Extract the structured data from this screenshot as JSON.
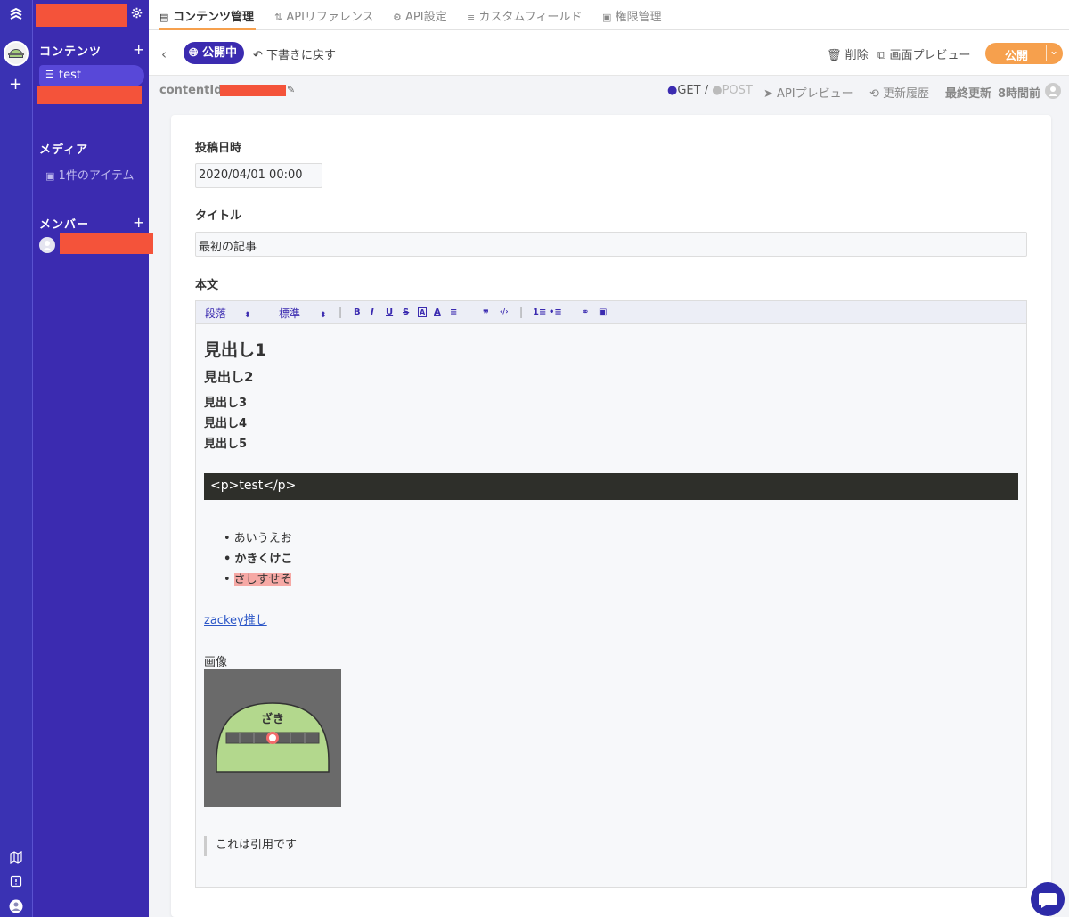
{
  "rail": {
    "plus": "+",
    "icons": [
      "map-icon",
      "alert-icon",
      "user-icon"
    ]
  },
  "sidebar": {
    "sections": [
      {
        "title": "コンテンツ",
        "plus": "+"
      },
      {
        "title": "メディア"
      },
      {
        "title": "メンバー",
        "plus": "+"
      }
    ],
    "api_item": "test",
    "media_item": "1件のアイテム"
  },
  "topnav": {
    "tabs": [
      "コンテンツ管理",
      "APIリファレンス",
      "API設定",
      "カスタムフィールド",
      "権限管理"
    ],
    "active_index": 0
  },
  "actionbar": {
    "status": "公開中",
    "revert": "下書きに戻す",
    "delete": "削除",
    "preview": "画面プレビュー",
    "publish": "公開"
  },
  "meta": {
    "content_id_label": "contentId",
    "get": "GET",
    "slash": "/",
    "post": "POST",
    "api_preview": "APIプレビュー",
    "history": "更新履歴",
    "last_updated_label": "最終更新",
    "last_updated_value": "8時間前"
  },
  "form": {
    "date_label": "投稿日時",
    "date_value": "2020/04/01 00:00",
    "title_label": "タイトル",
    "title_value": "最初の記事",
    "body_label": "本文"
  },
  "toolbar": {
    "paragraph": "段落",
    "size": "標準",
    "buttons": [
      "B",
      "I",
      "U",
      "S",
      "A",
      "A",
      "≡",
      "❞",
      "‹/›",
      "|",
      "1≡",
      "•≡",
      "🔗",
      "▣"
    ]
  },
  "content": {
    "h1": "見出し1",
    "h2": "見出し2",
    "h3": "見出し3",
    "h4": "見出し4",
    "h5": "見出し5",
    "code": "<p>test</p>",
    "list": [
      "あいうえお",
      "かきくけこ",
      "さしすせそ"
    ],
    "link": "zackey推し",
    "image_caption": "画像",
    "image_text": "ざき",
    "quote": "これは引用です"
  },
  "colors": {
    "sidebar": "#3b2bb0",
    "accent": "#f6a04d",
    "highlight": "#f6a9a5",
    "link": "#2c57c7"
  }
}
